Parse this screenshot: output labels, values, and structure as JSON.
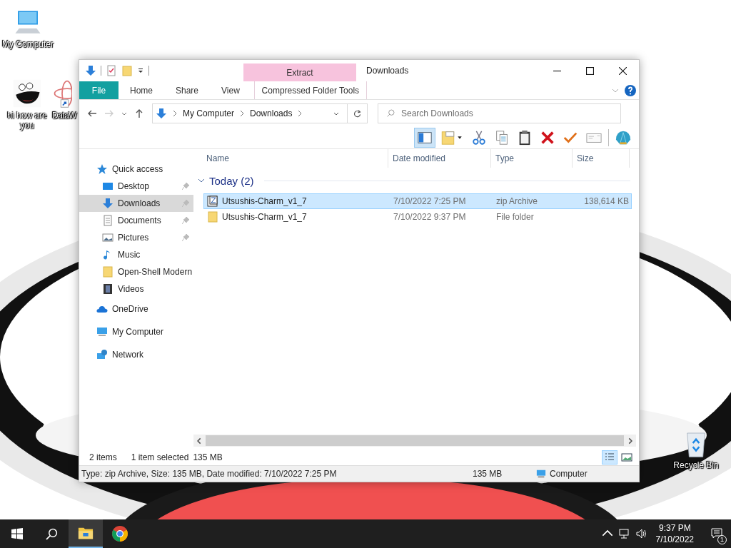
{
  "desktop_icons": [
    {
      "label": "My Computer",
      "kind": "computer"
    },
    {
      "label": "hi how are you",
      "kind": "cartoon"
    },
    {
      "label": "DataW",
      "kind": "shortcut"
    },
    {
      "label": "Recycle Bin",
      "kind": "bin"
    }
  ],
  "window": {
    "title": "Downloads",
    "ribbon": {
      "contextual_tab": "Extract",
      "contextual_group": "Compressed Folder Tools",
      "tabs": [
        {
          "label": "File",
          "kind": "file"
        },
        {
          "label": "Home",
          "kind": "tab"
        },
        {
          "label": "Share",
          "kind": "tab"
        },
        {
          "label": "View",
          "kind": "tab"
        }
      ]
    },
    "address": {
      "crumbs": [
        "My Computer",
        "Downloads"
      ]
    },
    "search": {
      "placeholder": "Search Downloads"
    },
    "toolbar_buttons": [
      {
        "kind": "pane",
        "on": true
      },
      {
        "kind": "folder-options"
      },
      {
        "kind": "cut"
      },
      {
        "kind": "copy"
      },
      {
        "kind": "paste"
      },
      {
        "kind": "delete"
      },
      {
        "kind": "check"
      },
      {
        "kind": "mail"
      },
      {
        "kind": "shell"
      }
    ],
    "sidebar": {
      "items": [
        {
          "label": "Quick access",
          "kind": "star",
          "selected": false,
          "children": [
            {
              "label": "Desktop",
              "kind": "desktop",
              "pinned": true,
              "selected": false
            },
            {
              "label": "Downloads",
              "kind": "downloads",
              "pinned": true,
              "selected": true
            },
            {
              "label": "Documents",
              "kind": "documents",
              "pinned": true,
              "selected": false
            },
            {
              "label": "Pictures",
              "kind": "pictures",
              "pinned": true,
              "selected": false
            },
            {
              "label": "Music",
              "kind": "music",
              "pinned": false,
              "selected": false
            },
            {
              "label": "Open-Shell Modern",
              "kind": "folder",
              "pinned": false,
              "selected": false
            },
            {
              "label": "Videos",
              "kind": "videos",
              "pinned": false,
              "selected": false
            }
          ]
        },
        {
          "label": "OneDrive",
          "kind": "cloud",
          "selected": false
        },
        {
          "label": "My Computer",
          "kind": "computer",
          "selected": false
        },
        {
          "label": "Network",
          "kind": "network",
          "selected": false
        }
      ]
    },
    "columns": [
      "Name",
      "Date modified",
      "Type",
      "Size"
    ],
    "group": {
      "label": "Today (2)",
      "expanded": true
    },
    "rows": [
      {
        "name": "Utsushis-Charm_v1_7",
        "date": "7/10/2022 7:25 PM",
        "type": "zip Archive",
        "size": "138,614 KB",
        "kind": "zip",
        "selected": true
      },
      {
        "name": "Utsushis-Charm_v1_7",
        "date": "7/10/2022 9:37 PM",
        "type": "File folder",
        "kind": "folder",
        "selected": false
      }
    ],
    "status": {
      "count": "2 items",
      "selection": "1 item selected",
      "size": "135 MB"
    },
    "view_buttons": [
      {
        "kind": "details",
        "selected": true
      },
      {
        "kind": "large-icons",
        "selected": false
      }
    ],
    "details_bar": {
      "info": "Type: zip Archive, Size: 135 MB, Date modified: 7/10/2022 7:25 PM",
      "size": "135 MB",
      "location": "Computer"
    }
  },
  "taskbar": {
    "time": "9:37 PM",
    "date": "7/10/2022",
    "notifications": "1"
  }
}
